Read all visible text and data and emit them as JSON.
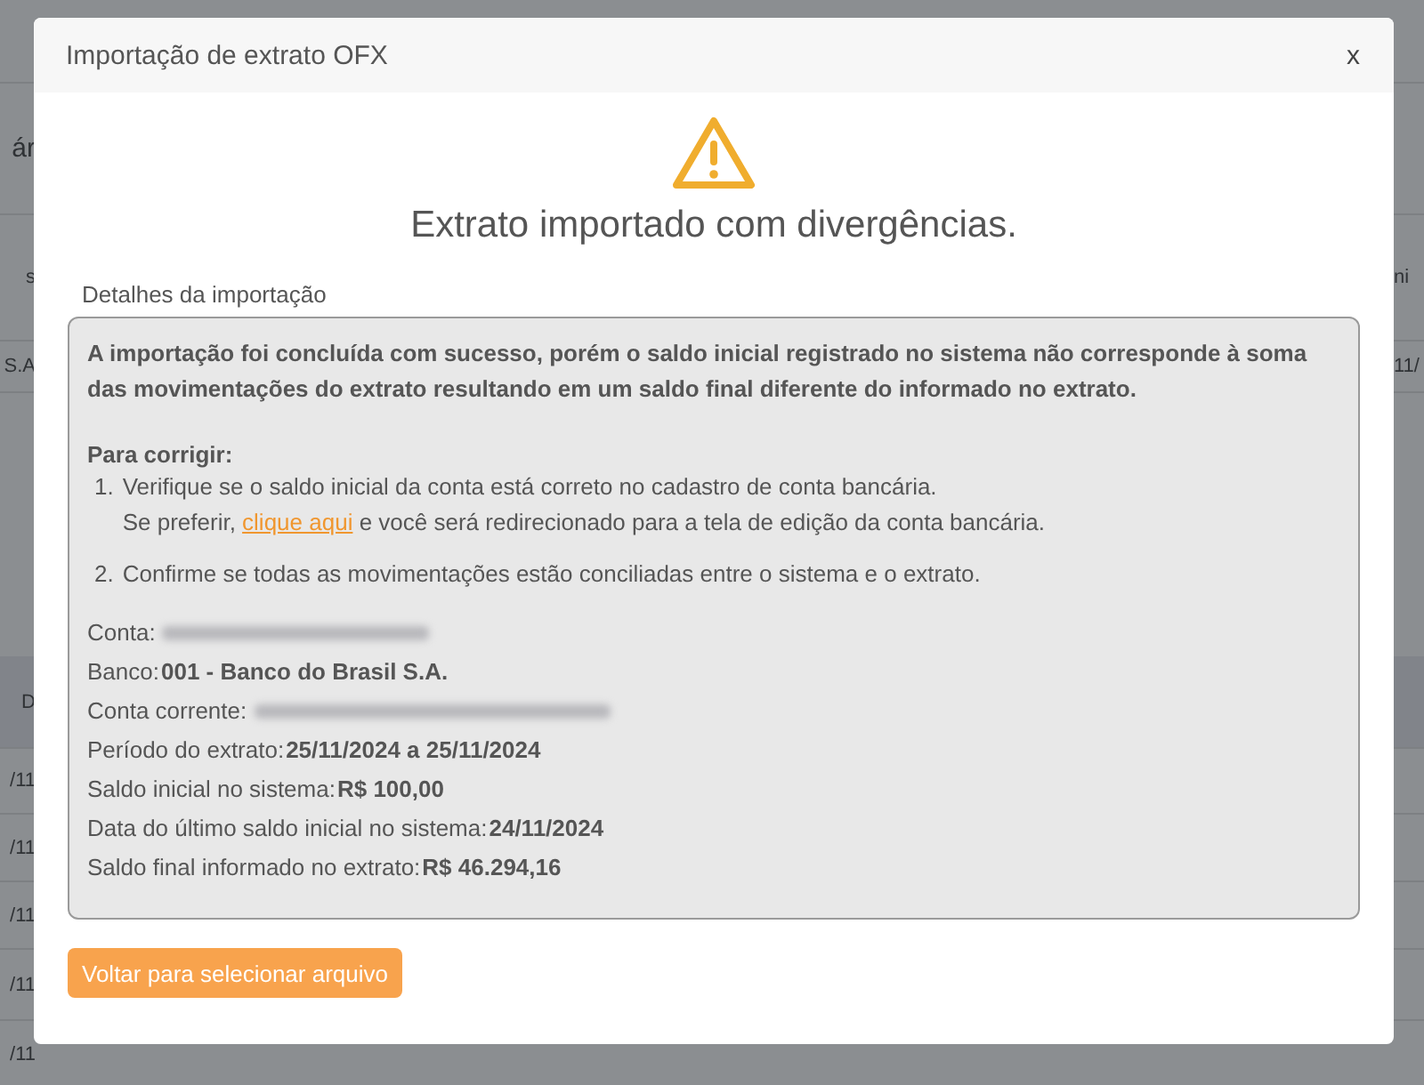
{
  "background": {
    "top_rows": [
      {
        "left": "ár"
      },
      {
        "left": "s",
        "right": "ni"
      },
      {
        "left": "S.A",
        "right": "11/"
      }
    ],
    "table_header": {
      "left": "D"
    },
    "table_rows": [
      {
        "left": "/11"
      },
      {
        "left": "/11"
      },
      {
        "left": "/11"
      },
      {
        "left": "/11"
      },
      {
        "left": "/11"
      }
    ]
  },
  "dialog": {
    "title": "Importação de extrato OFX",
    "close": "x",
    "status": {
      "kind": "warning",
      "heading": "Extrato importado com divergências."
    },
    "section_label": "Detalhes da importação",
    "message": "A importação foi concluída com sucesso, porém o saldo inicial registrado no sistema não corresponde à soma das movimentações do extrato resultando em um saldo final diferente do informado no extrato.",
    "fix_heading": "Para corrigir:",
    "steps": [
      {
        "number": "1.",
        "text": "Verifique se o saldo inicial da conta está correto no cadastro de conta bancária.",
        "before_link": "Se preferir, ",
        "link": "clique aqui",
        "after_link": " e você será redirecionado para a tela de edição da conta bancária."
      },
      {
        "number": "2.",
        "text": "Confirme se todas as movimentações estão conciliadas entre o sistema e o extrato."
      }
    ],
    "details": [
      {
        "label": "Conta:",
        "kind": "redacted"
      },
      {
        "label": "Banco:",
        "kind": "value",
        "value": "001 - Banco do Brasil S.A."
      },
      {
        "label": "Conta corrente:",
        "kind": "redacted"
      },
      {
        "label": "Período do extrato:",
        "kind": "value",
        "value": "25/11/2024 a 25/11/2024"
      },
      {
        "label": "Saldo inicial no sistema:",
        "kind": "value",
        "value": "R$ 100,00"
      },
      {
        "label": "Data do último saldo inicial no sistema:",
        "kind": "value",
        "value": "24/11/2024"
      },
      {
        "label": "Saldo final informado no extrato:",
        "kind": "value",
        "value": "R$ 46.294,16"
      }
    ],
    "button": "Voltar para selecionar arquivo"
  }
}
